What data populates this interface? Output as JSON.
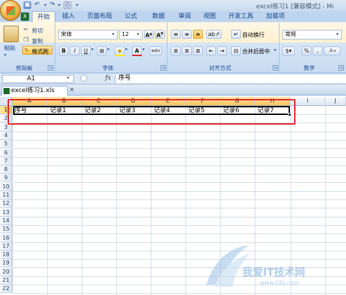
{
  "titlebar": {
    "title": "excel练习1  [兼容模式] - Mi"
  },
  "tabs": [
    {
      "label": "开始",
      "active": true
    },
    {
      "label": "插入"
    },
    {
      "label": "页面布局"
    },
    {
      "label": "公式"
    },
    {
      "label": "数据"
    },
    {
      "label": "审阅"
    },
    {
      "label": "视图"
    },
    {
      "label": "开发工具"
    },
    {
      "label": "加载项"
    }
  ],
  "ribbon": {
    "clipboard": {
      "group_label": "剪贴板",
      "paste": "粘贴",
      "cut": "剪切",
      "copy": "复制",
      "format_painter": "格式刷"
    },
    "font": {
      "group_label": "字体",
      "font_name": "宋体",
      "font_size": "12",
      "bold": "B",
      "italic": "I",
      "underline": "U",
      "grow": "A",
      "shrink": "A",
      "font_color_letter": "A",
      "phonetic": "wén"
    },
    "alignment": {
      "group_label": "对齐方式",
      "wrap_text": "自动换行",
      "merge_center": "合并后居中"
    },
    "number": {
      "group_label": "数字",
      "format": "常规",
      "percent": "%",
      "comma": ","
    }
  },
  "formula_bar": {
    "name_box": "A1",
    "fx": "fx",
    "content": "序号"
  },
  "workbook_tab": {
    "name": "excel练习1.xls",
    "close": "×"
  },
  "sheet": {
    "columns": [
      "A",
      "B",
      "C",
      "D",
      "E",
      "F",
      "G",
      "H",
      "I",
      "J"
    ],
    "rows": [
      "1",
      "2",
      "3",
      "4",
      "5",
      "6",
      "7",
      "8",
      "9",
      "10",
      "11",
      "12",
      "13",
      "14",
      "15",
      "16",
      "17",
      "18",
      "19",
      "20",
      "21",
      "22"
    ],
    "row1": [
      "序号",
      "记录1",
      "记录2",
      "记录3",
      "记录4",
      "记录5",
      "记录6",
      "记录7"
    ]
  },
  "watermark": {
    "text": "我爱IT技术网",
    "url": "www.52ij.com"
  }
}
